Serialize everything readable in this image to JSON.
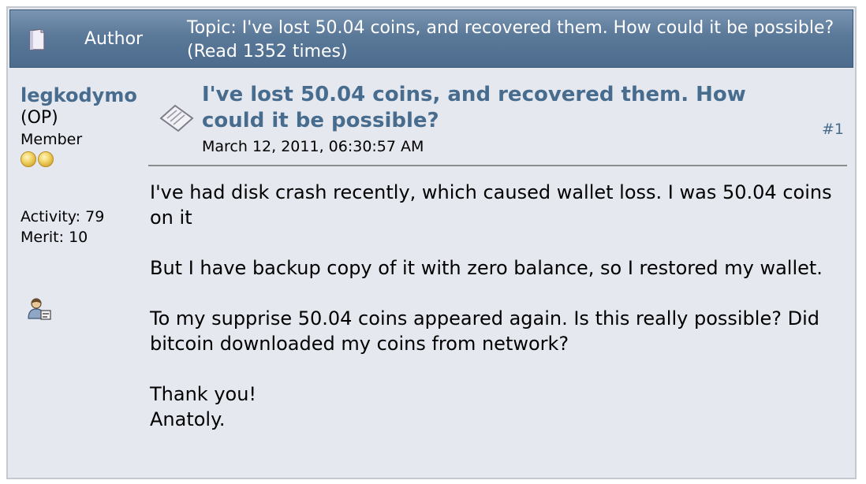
{
  "header": {
    "author_label": "Author",
    "topic_line": "Topic: I've lost 50.04 coins, and recovered them. How could it be possible?  (Read 1352 times)"
  },
  "poster": {
    "name": "legkodymo",
    "op_tag": "(OP)",
    "rank": "Member",
    "rank_coins": 2,
    "activity": "Activity: 79",
    "merit": "Merit: 10"
  },
  "post": {
    "title": "I've lost 50.04 coins, and recovered them. How could it be possible?",
    "date": "March 12, 2011, 06:30:57 AM",
    "number": "#1",
    "paragraphs": [
      "I've had disk crash recently, which caused wallet loss. I was 50.04 coins on it",
      "But I have backup copy of it with zero balance, so I restored my wallet.",
      "To my supprise 50.04 coins appeared again. Is this really possible? Did bitcoin downloaded my coins from network?",
      "Thank you!",
      "Anatoly."
    ]
  },
  "colors": {
    "header_bg": "#5a7898",
    "link": "#476c8e",
    "post_bg": "#e5e8ef"
  }
}
